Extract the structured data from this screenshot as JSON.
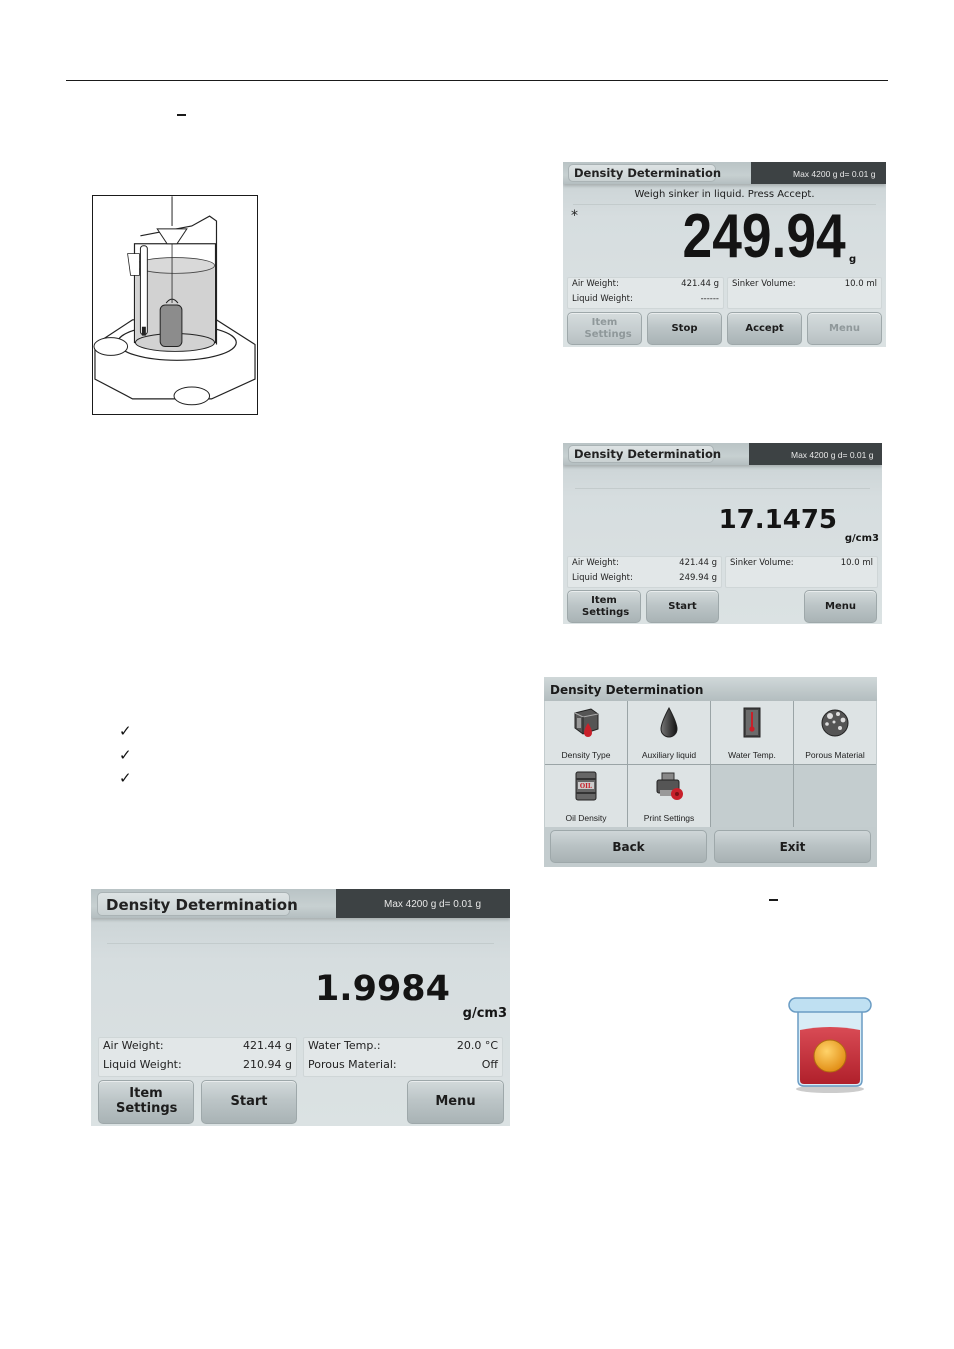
{
  "document": {
    "dashes": [
      "–",
      "–"
    ],
    "checklist": [
      "✓",
      "✓",
      "✓"
    ],
    "figures": {
      "apparatus": "density-kit-illustration",
      "beaker": "beaker-icon"
    }
  },
  "screens": {
    "weigh_liquid": {
      "title": "Density Determination",
      "capacity": "Max 4200 g   d= 0.01 g",
      "prompt": "Weigh sinker in liquid. Press Accept.",
      "stability_indicator": "*",
      "reading": "249.94",
      "unit": "g",
      "info_left": [
        {
          "label": "Air Weight:",
          "value": "421.44 g"
        },
        {
          "label": "Liquid Weight:",
          "value": "------"
        }
      ],
      "info_right": [
        {
          "label": "Sinker Volume:",
          "value": "10.0 ml"
        }
      ],
      "buttons": [
        {
          "label": "Item Settings",
          "enabled": false
        },
        {
          "label": "Stop",
          "enabled": true
        },
        {
          "label": "Accept",
          "enabled": true
        },
        {
          "label": "Menu",
          "enabled": false
        }
      ]
    },
    "result_sinker": {
      "title": "Density Determination",
      "capacity": "Max 4200 g   d= 0.01 g",
      "reading": "17.1475",
      "unit": "g/cm3",
      "info_left": [
        {
          "label": "Air Weight:",
          "value": "421.44 g"
        },
        {
          "label": "Liquid Weight:",
          "value": "249.94 g"
        }
      ],
      "info_right": [
        {
          "label": "Sinker Volume:",
          "value": "10.0 ml"
        }
      ],
      "buttons": [
        {
          "label": "Item Settings",
          "enabled": true
        },
        {
          "label": "Start",
          "enabled": true
        },
        {
          "label": "Menu",
          "enabled": true
        }
      ]
    },
    "settings_menu": {
      "title": "Density Determination",
      "items": [
        {
          "label": "Density Type",
          "icon": "density-type-icon"
        },
        {
          "label": "Auxiliary liquid",
          "icon": "liquid-drop-icon"
        },
        {
          "label": "Water Temp.",
          "icon": "thermometer-icon"
        },
        {
          "label": "Porous Material",
          "icon": "porous-material-icon"
        },
        {
          "label": "Oil Density",
          "icon": "oil-barrel-icon",
          "barrel_text": "OIL"
        },
        {
          "label": "Print Settings",
          "icon": "printer-settings-icon"
        }
      ],
      "back_label": "Back",
      "exit_label": "Exit"
    },
    "result_solid": {
      "title": "Density Determination",
      "capacity": "Max 4200 g   d= 0.01 g",
      "reading": "1.9984",
      "unit": "g/cm3",
      "info_left": [
        {
          "label": "Air Weight:",
          "value": "421.44 g"
        },
        {
          "label": "Liquid Weight:",
          "value": "210.94 g"
        }
      ],
      "info_right": [
        {
          "label": "Water Temp.:",
          "value": "20.0 °C"
        },
        {
          "label": "Porous Material:",
          "value": "Off"
        }
      ],
      "buttons": [
        {
          "label": "Item Settings",
          "enabled": true
        },
        {
          "label": "Start",
          "enabled": true
        },
        {
          "label": "Menu",
          "enabled": true
        }
      ]
    }
  },
  "colors": {
    "screen_bg": "#d6dddf",
    "capacity_box": "#3d4244",
    "button": "#bcc5c7",
    "accent_red": "#c8202a"
  }
}
